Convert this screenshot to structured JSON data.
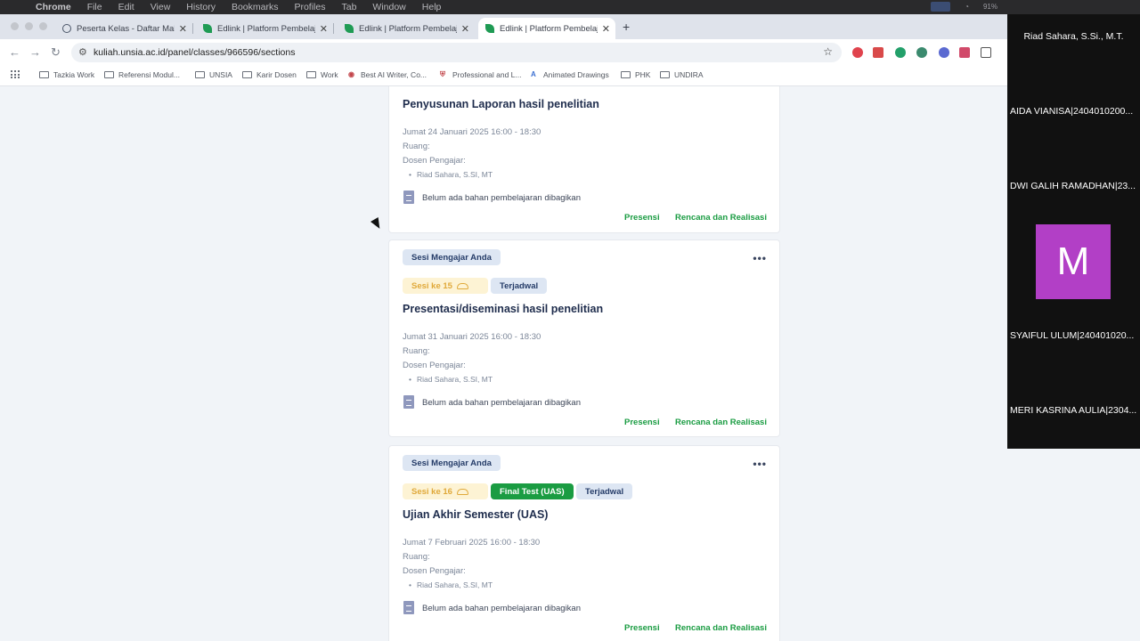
{
  "menubar": {
    "app": "Chrome",
    "items": [
      "File",
      "Edit",
      "View",
      "History",
      "Bookmarks",
      "Profiles",
      "Tab",
      "Window",
      "Help"
    ],
    "battery": "91%"
  },
  "tabs": [
    {
      "title": "Peserta Kelas - Daftar Mahas"
    },
    {
      "title": "Edlink | Platform Pembelajara"
    },
    {
      "title": "Edlink | Platform Pembelajara"
    },
    {
      "title": "Edlink | Platform Pembelajara"
    }
  ],
  "address": {
    "url": "kuliah.unsia.ac.id/panel/classes/966596/sections"
  },
  "bookmarks": [
    "Tazkia Work",
    "Referensi Modul...",
    "UNSIA",
    "Karir Dosen",
    "Work",
    "Best AI Writer, Co...",
    "Professional and L...",
    "Animated Drawings",
    "PHK",
    "UNDIRA"
  ],
  "labels": {
    "room": "Ruang:",
    "lecturer": "Dosen Pengajar:",
    "no_material": "Belum ada bahan pembelajaran dibagikan",
    "presensi": "Presensi",
    "rencana": "Rencana dan Realisasi",
    "role": "Sesi Mengajar Anda",
    "scheduled": "Terjadwal"
  },
  "sessions": [
    {
      "title": "Penyusunan Laporan hasil penelitian",
      "datetime": "Jumat 24 Januari 2025 16:00 - 18:30",
      "lecturer": "Riad Sahara, S.SI, MT"
    },
    {
      "badge": "Sesi ke 15",
      "title": "Presentasi/diseminasi hasil penelitian",
      "datetime": "Jumat 31 Januari 2025 16:00 - 18:30",
      "lecturer": "Riad Sahara, S.SI, MT"
    },
    {
      "badge": "Sesi ke 16",
      "type": "Final Test (UAS)",
      "title": "Ujian Akhir Semester (UAS)",
      "datetime": "Jumat 7 Februari 2025 16:00 - 18:30",
      "lecturer": "Riad Sahara, S.SI, MT"
    }
  ],
  "participants": {
    "host": "Riad Sahara, S.Si., M.T.",
    "list": [
      "AIDA VIANISA|2404010200...",
      "DWI GALIH RAMADHAN|23...",
      "SYAIFUL ULUM|240401020...",
      "MERI KASRINA AULIA|2304..."
    ],
    "avatar_letter": "M"
  },
  "colors": {
    "accent_green": "#1a9c42",
    "avatar_purple": "#b23fc6",
    "badge_yellow": "#fdf3d4"
  }
}
